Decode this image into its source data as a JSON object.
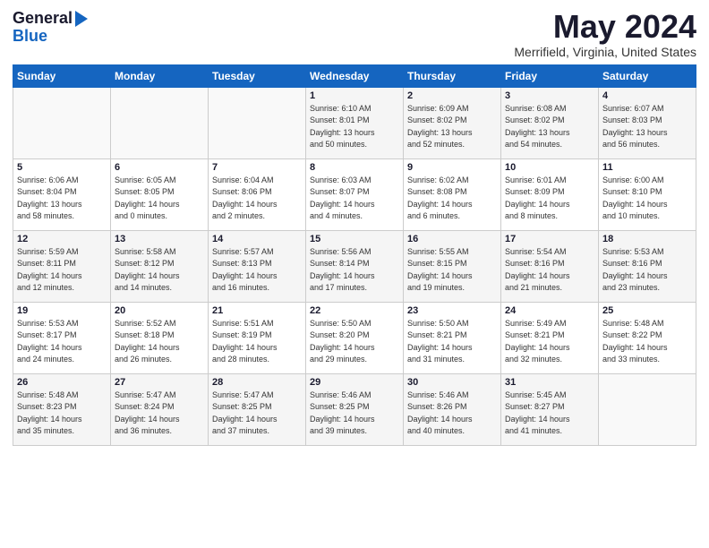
{
  "logo": {
    "general": "General",
    "blue": "Blue"
  },
  "title": "May 2024",
  "location": "Merrifield, Virginia, United States",
  "header_days": [
    "Sunday",
    "Monday",
    "Tuesday",
    "Wednesday",
    "Thursday",
    "Friday",
    "Saturday"
  ],
  "weeks": [
    [
      {
        "day": "",
        "info": ""
      },
      {
        "day": "",
        "info": ""
      },
      {
        "day": "",
        "info": ""
      },
      {
        "day": "1",
        "info": "Sunrise: 6:10 AM\nSunset: 8:01 PM\nDaylight: 13 hours\nand 50 minutes."
      },
      {
        "day": "2",
        "info": "Sunrise: 6:09 AM\nSunset: 8:02 PM\nDaylight: 13 hours\nand 52 minutes."
      },
      {
        "day": "3",
        "info": "Sunrise: 6:08 AM\nSunset: 8:02 PM\nDaylight: 13 hours\nand 54 minutes."
      },
      {
        "day": "4",
        "info": "Sunrise: 6:07 AM\nSunset: 8:03 PM\nDaylight: 13 hours\nand 56 minutes."
      }
    ],
    [
      {
        "day": "5",
        "info": "Sunrise: 6:06 AM\nSunset: 8:04 PM\nDaylight: 13 hours\nand 58 minutes."
      },
      {
        "day": "6",
        "info": "Sunrise: 6:05 AM\nSunset: 8:05 PM\nDaylight: 14 hours\nand 0 minutes."
      },
      {
        "day": "7",
        "info": "Sunrise: 6:04 AM\nSunset: 8:06 PM\nDaylight: 14 hours\nand 2 minutes."
      },
      {
        "day": "8",
        "info": "Sunrise: 6:03 AM\nSunset: 8:07 PM\nDaylight: 14 hours\nand 4 minutes."
      },
      {
        "day": "9",
        "info": "Sunrise: 6:02 AM\nSunset: 8:08 PM\nDaylight: 14 hours\nand 6 minutes."
      },
      {
        "day": "10",
        "info": "Sunrise: 6:01 AM\nSunset: 8:09 PM\nDaylight: 14 hours\nand 8 minutes."
      },
      {
        "day": "11",
        "info": "Sunrise: 6:00 AM\nSunset: 8:10 PM\nDaylight: 14 hours\nand 10 minutes."
      }
    ],
    [
      {
        "day": "12",
        "info": "Sunrise: 5:59 AM\nSunset: 8:11 PM\nDaylight: 14 hours\nand 12 minutes."
      },
      {
        "day": "13",
        "info": "Sunrise: 5:58 AM\nSunset: 8:12 PM\nDaylight: 14 hours\nand 14 minutes."
      },
      {
        "day": "14",
        "info": "Sunrise: 5:57 AM\nSunset: 8:13 PM\nDaylight: 14 hours\nand 16 minutes."
      },
      {
        "day": "15",
        "info": "Sunrise: 5:56 AM\nSunset: 8:14 PM\nDaylight: 14 hours\nand 17 minutes."
      },
      {
        "day": "16",
        "info": "Sunrise: 5:55 AM\nSunset: 8:15 PM\nDaylight: 14 hours\nand 19 minutes."
      },
      {
        "day": "17",
        "info": "Sunrise: 5:54 AM\nSunset: 8:16 PM\nDaylight: 14 hours\nand 21 minutes."
      },
      {
        "day": "18",
        "info": "Sunrise: 5:53 AM\nSunset: 8:16 PM\nDaylight: 14 hours\nand 23 minutes."
      }
    ],
    [
      {
        "day": "19",
        "info": "Sunrise: 5:53 AM\nSunset: 8:17 PM\nDaylight: 14 hours\nand 24 minutes."
      },
      {
        "day": "20",
        "info": "Sunrise: 5:52 AM\nSunset: 8:18 PM\nDaylight: 14 hours\nand 26 minutes."
      },
      {
        "day": "21",
        "info": "Sunrise: 5:51 AM\nSunset: 8:19 PM\nDaylight: 14 hours\nand 28 minutes."
      },
      {
        "day": "22",
        "info": "Sunrise: 5:50 AM\nSunset: 8:20 PM\nDaylight: 14 hours\nand 29 minutes."
      },
      {
        "day": "23",
        "info": "Sunrise: 5:50 AM\nSunset: 8:21 PM\nDaylight: 14 hours\nand 31 minutes."
      },
      {
        "day": "24",
        "info": "Sunrise: 5:49 AM\nSunset: 8:21 PM\nDaylight: 14 hours\nand 32 minutes."
      },
      {
        "day": "25",
        "info": "Sunrise: 5:48 AM\nSunset: 8:22 PM\nDaylight: 14 hours\nand 33 minutes."
      }
    ],
    [
      {
        "day": "26",
        "info": "Sunrise: 5:48 AM\nSunset: 8:23 PM\nDaylight: 14 hours\nand 35 minutes."
      },
      {
        "day": "27",
        "info": "Sunrise: 5:47 AM\nSunset: 8:24 PM\nDaylight: 14 hours\nand 36 minutes."
      },
      {
        "day": "28",
        "info": "Sunrise: 5:47 AM\nSunset: 8:25 PM\nDaylight: 14 hours\nand 37 minutes."
      },
      {
        "day": "29",
        "info": "Sunrise: 5:46 AM\nSunset: 8:25 PM\nDaylight: 14 hours\nand 39 minutes."
      },
      {
        "day": "30",
        "info": "Sunrise: 5:46 AM\nSunset: 8:26 PM\nDaylight: 14 hours\nand 40 minutes."
      },
      {
        "day": "31",
        "info": "Sunrise: 5:45 AM\nSunset: 8:27 PM\nDaylight: 14 hours\nand 41 minutes."
      },
      {
        "day": "",
        "info": ""
      }
    ]
  ]
}
